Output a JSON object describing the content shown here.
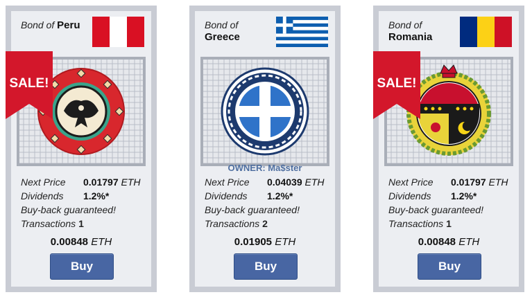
{
  "cards": [
    {
      "bond_of": "Bond of",
      "country": "Peru",
      "sale_label": "SALE!",
      "owner": "",
      "next_price_label": "Next Price",
      "next_price_value": "0.01797",
      "next_price_unit": "ETH",
      "dividends_label": "Dividends",
      "dividends_value": "1.2%*",
      "buyback": "Buy-back guaranteed!",
      "transactions_label": "Transactions",
      "transactions_value": "1",
      "price_value": "0.00848",
      "price_unit": "ETH",
      "buy_label": "Buy"
    },
    {
      "bond_of": "Bond of",
      "country": "Greece",
      "sale_label": "",
      "owner": "OWNER: Ma$ster",
      "next_price_label": "Next Price",
      "next_price_value": "0.04039",
      "next_price_unit": "ETH",
      "dividends_label": "Dividends",
      "dividends_value": "1.2%*",
      "buyback": "Buy-back guaranteed!",
      "transactions_label": "Transactions",
      "transactions_value": "2",
      "price_value": "0.01905",
      "price_unit": "ETH",
      "buy_label": "Buy"
    },
    {
      "bond_of": "Bond of",
      "country": "Romania",
      "sale_label": "SALE!",
      "owner": "",
      "next_price_label": "Next Price",
      "next_price_value": "0.01797",
      "next_price_unit": "ETH",
      "dividends_label": "Dividends",
      "dividends_value": "1.2%*",
      "buyback": "Buy-back guaranteed!",
      "transactions_label": "Transactions",
      "transactions_value": "1",
      "price_value": "0.00848",
      "price_unit": "ETH",
      "buy_label": "Buy"
    }
  ],
  "icons": [
    "peru-flag-icon",
    "greece-flag-icon",
    "romania-flag-icon",
    "peru-emblem-icon",
    "greece-emblem-icon",
    "romania-emblem-icon",
    "sale-ribbon-icon"
  ],
  "colors": {
    "card_border": "#c9ccd4",
    "card_bg": "#eceef2",
    "button_bg": "#4866a3",
    "owner_text": "#4f6fa0",
    "sale_red": "#d3172b"
  }
}
